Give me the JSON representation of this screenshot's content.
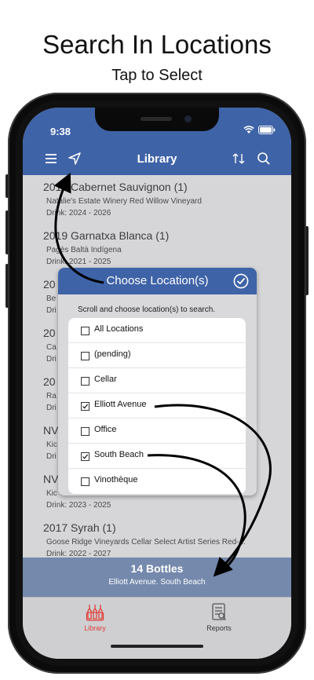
{
  "promo": {
    "headline": "Search In Locations",
    "subheadline": "Tap to Select"
  },
  "status_bar": {
    "time": "9:38"
  },
  "nav": {
    "title": "Library",
    "icons": [
      "menu-icon",
      "location-arrow-icon",
      "sort-icon",
      "search-icon"
    ]
  },
  "wine_list": [
    {
      "title": "2019 Cabernet Sauvignon (1)",
      "producer": "Natalie's Estate Winery Red Willow Vineyard",
      "drink": "Drink:  2024 - 2026"
    },
    {
      "title": "2019 Garnatxa Blanca (1)",
      "producer": "Pagès Baltà Indígena",
      "drink": "Drink:  2021 - 2025"
    },
    {
      "title": "20",
      "producer": "Be",
      "drink": "Dri"
    },
    {
      "title": "20",
      "producer": "Ca",
      "drink": "Dri"
    },
    {
      "title": "20",
      "producer": "Ra",
      "drink": "Dri"
    },
    {
      "title": "NV",
      "producer": "Kic",
      "drink": "Dri"
    },
    {
      "title": "NV",
      "producer": "Kic",
      "drink": "Drink:  2023 - 2025"
    },
    {
      "title": "2017 Syrah (1)",
      "producer": "Goose Ridge Vineyards Cellar Select Artist Series Red-...",
      "drink": "Drink:  2022 - 2027"
    }
  ],
  "summary": {
    "count": "14 Bottles",
    "locations": "Elliott Avenue. South Beach"
  },
  "modal": {
    "title": "Choose Location(s)",
    "hint": "Scroll and choose location(s) to search.",
    "options": [
      {
        "label": "All Locations",
        "checked": false
      },
      {
        "label": "(pending)",
        "checked": false
      },
      {
        "label": "Cellar",
        "checked": false
      },
      {
        "label": "Elliott Avenue",
        "checked": true
      },
      {
        "label": "Office",
        "checked": false
      },
      {
        "label": "South Beach",
        "checked": true
      },
      {
        "label": "Vinothèque",
        "checked": false
      }
    ]
  },
  "tabs": [
    {
      "label": "Library",
      "active": true,
      "icon": "bottles-icon"
    },
    {
      "label": "Reports",
      "active": false,
      "icon": "report-icon"
    }
  ],
  "colors": {
    "primary": "#3f63a7",
    "summary_bar": "#7589ad",
    "tab_active": "#e0403a",
    "tab_inactive": "#333333"
  }
}
